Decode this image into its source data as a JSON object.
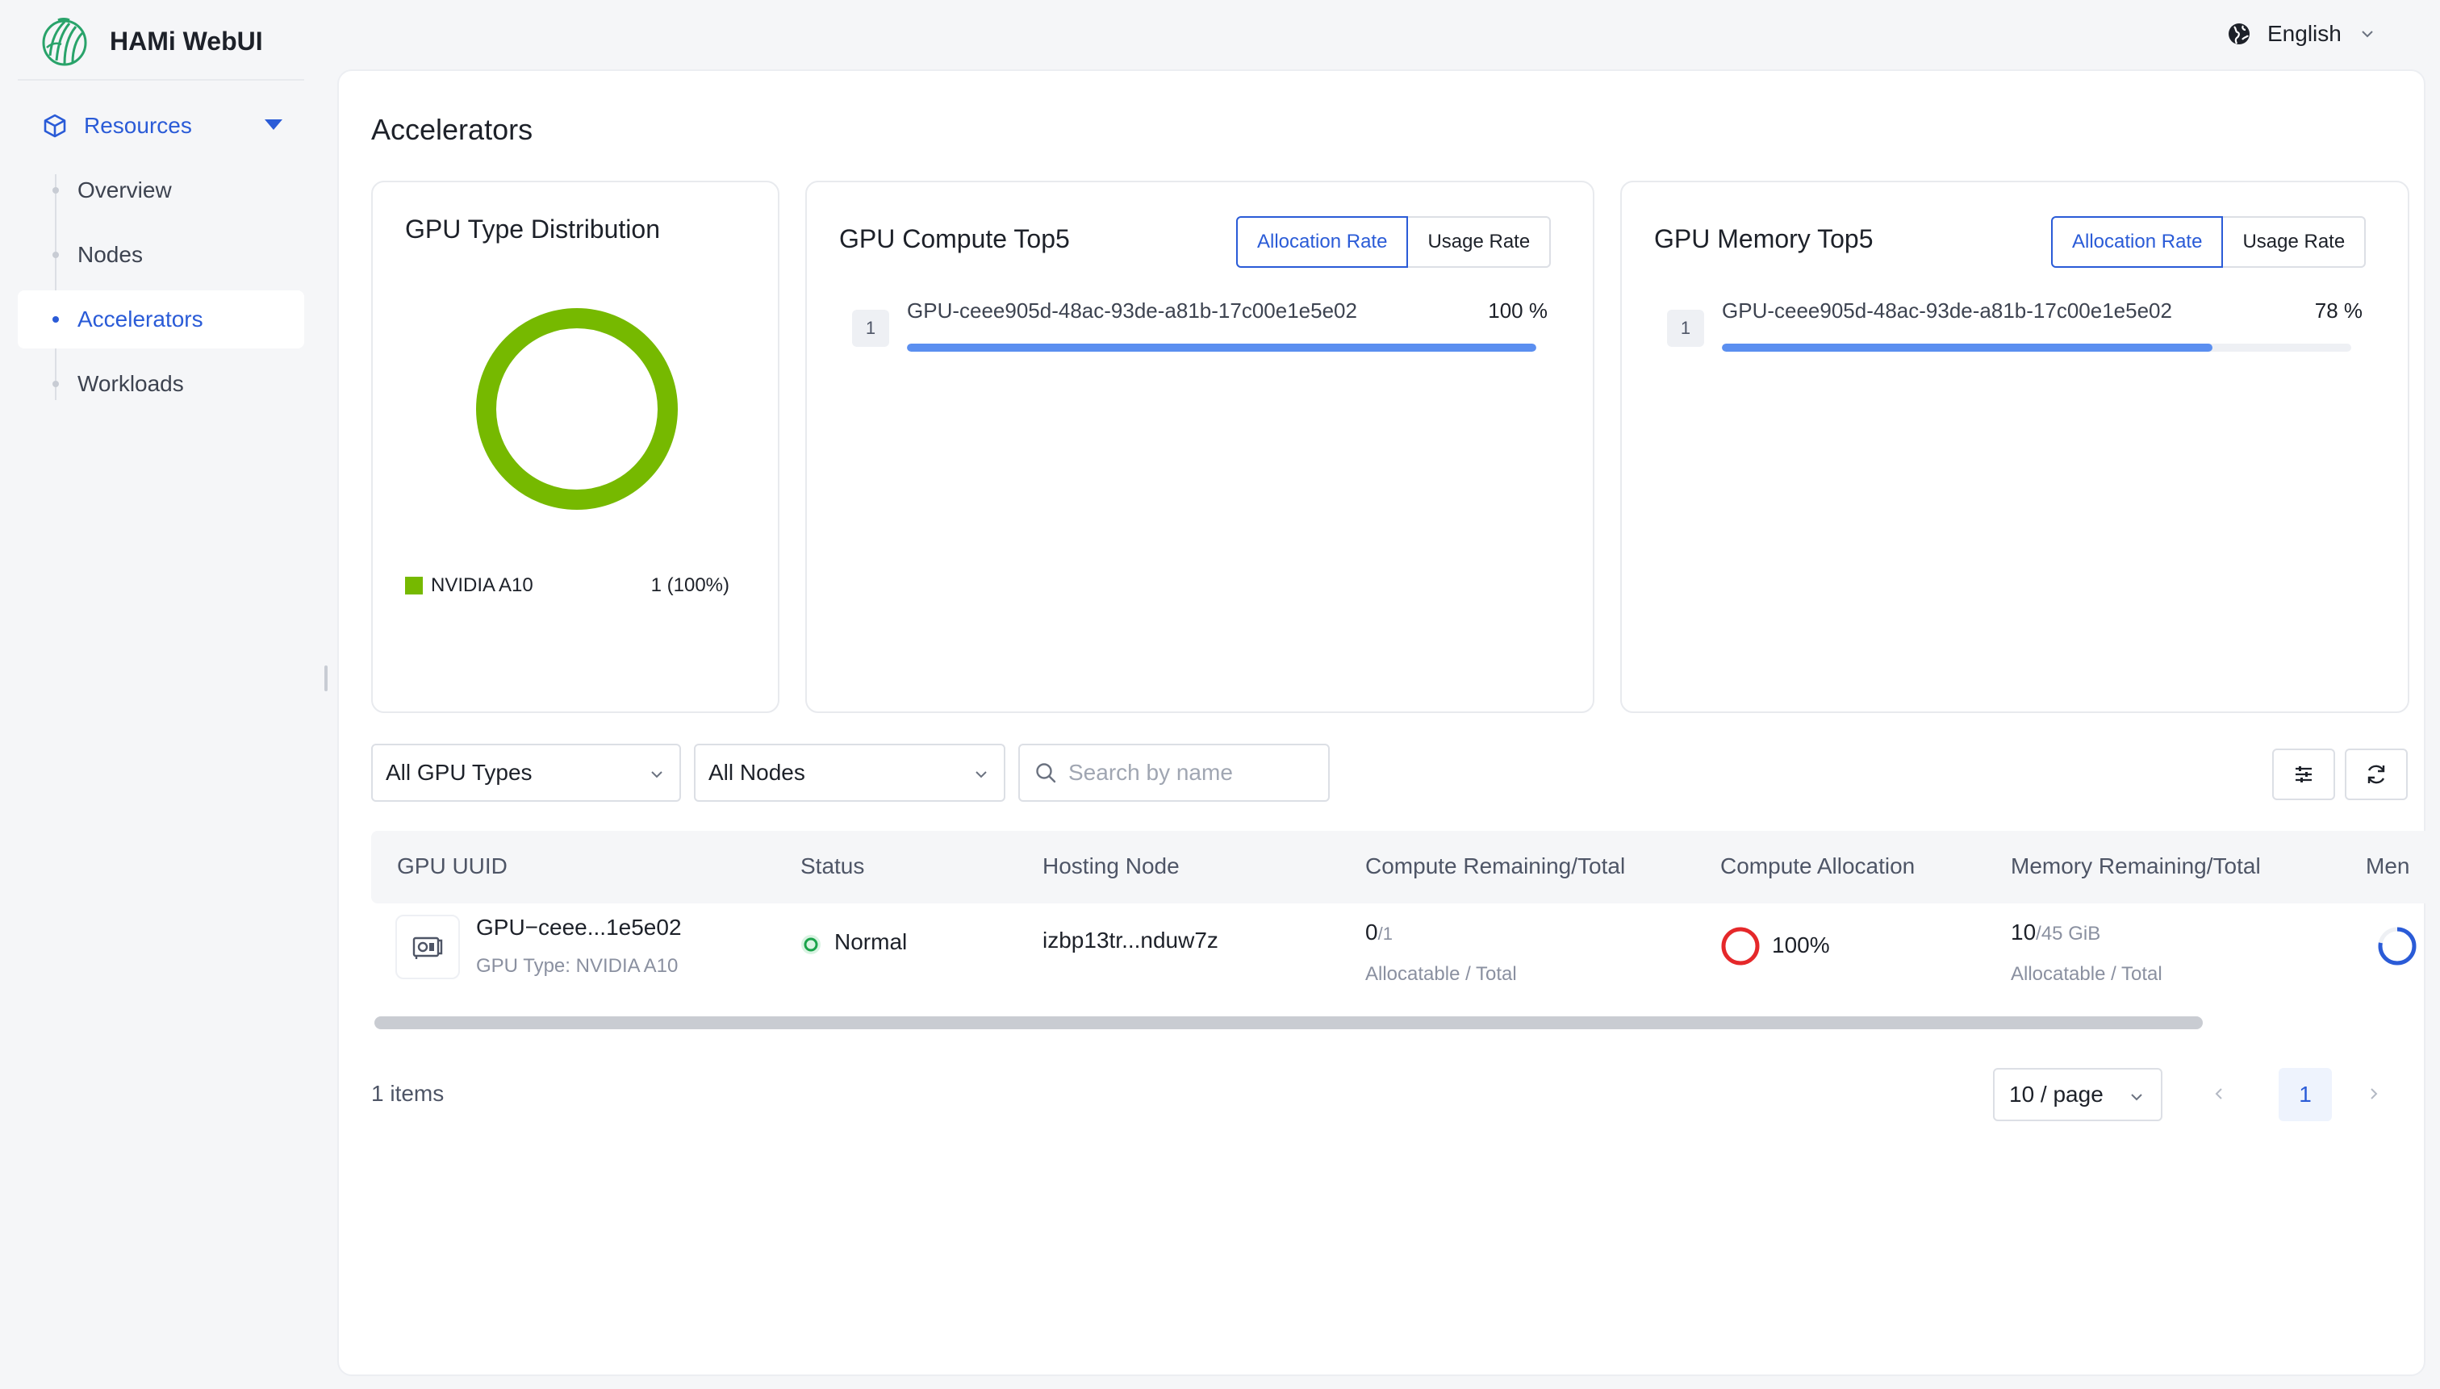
{
  "app": {
    "name": "HAMi WebUI"
  },
  "language": {
    "label": "English"
  },
  "sidebar": {
    "group_label": "Resources",
    "items": [
      {
        "label": "Overview"
      },
      {
        "label": "Nodes"
      },
      {
        "label": "Accelerators"
      },
      {
        "label": "Workloads"
      }
    ],
    "active_item": "Accelerators"
  },
  "page": {
    "title": "Accelerators"
  },
  "type_distribution": {
    "title": "GPU Type Distribution",
    "legend": [
      {
        "name": "NVIDIA A10",
        "value": "1 (100%)",
        "color": "#76b900",
        "fraction": 1.0
      }
    ]
  },
  "compute_top5": {
    "title": "GPU Compute Top5",
    "tabs": {
      "allocation": "Allocation Rate",
      "usage": "Usage Rate"
    },
    "rows": [
      {
        "rank": "1",
        "name": "GPU-ceee905d-48ac-93de-a81b-17c00e1e5e02",
        "value_text": "100 %",
        "percent": 100
      }
    ]
  },
  "memory_top5": {
    "title": "GPU Memory Top5",
    "tabs": {
      "allocation": "Allocation Rate",
      "usage": "Usage Rate"
    },
    "rows": [
      {
        "rank": "1",
        "name": "GPU-ceee905d-48ac-93de-a81b-17c00e1e5e02",
        "value_text": "78 %",
        "percent": 78
      }
    ]
  },
  "filters": {
    "gpu_type": "All GPU Types",
    "node": "All Nodes",
    "search_placeholder": "Search by name"
  },
  "table": {
    "columns": [
      "GPU UUID",
      "Status",
      "Hosting Node",
      "Compute Remaining/Total",
      "Compute Allocation",
      "Memory Remaining/Total",
      "Men"
    ],
    "rows": [
      {
        "uuid": "GPU−ceee...1e5e02",
        "gpu_type": "GPU Type: NVIDIA A10",
        "status": "Normal",
        "node": "izbp13tr...nduw7z",
        "compute_remaining": "0",
        "compute_total": "/1",
        "compute_caption": "Allocatable / Total",
        "compute_allocation": "100%",
        "compute_allocation_fraction": 1.0,
        "memory_remaining": "10",
        "memory_total": "/45 GiB",
        "memory_caption": "Allocatable / Total",
        "memory_allocation_fraction": 0.78
      }
    ]
  },
  "pagination": {
    "count_text": "1 items",
    "page_size": "10 / page",
    "current_page": "1"
  },
  "colors": {
    "accent": "#2a5bd7",
    "bar": "#5b8ff0",
    "nvidia_green": "#76b900",
    "status_ok": "#1aa34a",
    "alloc_red": "#e5282a"
  }
}
